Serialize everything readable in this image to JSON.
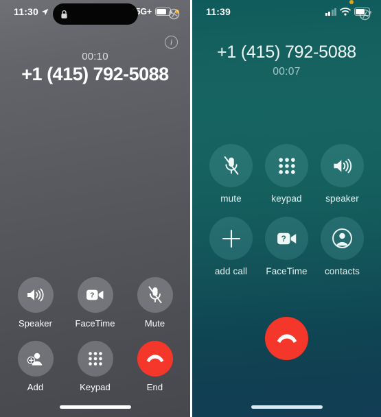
{
  "left_phone": {
    "status_bar": {
      "clock": "11:30",
      "location_icon": "location-arrow-icon",
      "island_lock_icon": "lock-icon",
      "signal_icon": "cellular-bars-icon",
      "network_label": "5G+",
      "battery_icon": "battery-icon",
      "battery_level_percent": 72,
      "mic_in_use_icon": "orange-privacy-dot-icon",
      "corner_icon": "screen-record-icon"
    },
    "info_button_label": "i",
    "call": {
      "duration": "00:10",
      "number": "+1 (415) 792-5088"
    },
    "buttons": [
      {
        "label": "Speaker",
        "icon": "speaker-icon",
        "style": "normal"
      },
      {
        "label": "FaceTime",
        "icon": "facetime-video-icon",
        "style": "normal"
      },
      {
        "label": "Mute",
        "icon": "mic-muted-icon",
        "style": "normal"
      },
      {
        "label": "Add",
        "icon": "add-contact-icon",
        "style": "normal"
      },
      {
        "label": "Keypad",
        "icon": "keypad-icon",
        "style": "normal"
      },
      {
        "label": "End",
        "icon": "end-call-icon",
        "style": "destructive"
      }
    ],
    "home_indicator": "home-indicator"
  },
  "right_phone": {
    "status_bar": {
      "clock": "11:39",
      "signal_icon": "cellular-bars-icon",
      "wifi_icon": "wifi-icon",
      "battery_icon": "battery-icon",
      "battery_level_percent": 70,
      "mic_in_use_icon": "orange-privacy-dot-icon",
      "corner_icon": "screen-record-icon"
    },
    "call": {
      "number": "+1 (415) 792-5088",
      "duration": "00:07"
    },
    "buttons": [
      {
        "label": "mute",
        "icon": "mic-muted-icon"
      },
      {
        "label": "keypad",
        "icon": "keypad-icon"
      },
      {
        "label": "speaker",
        "icon": "speaker-icon"
      },
      {
        "label": "add call",
        "icon": "plus-icon"
      },
      {
        "label": "FaceTime",
        "icon": "facetime-video-icon"
      },
      {
        "label": "contacts",
        "icon": "contacts-person-icon"
      }
    ],
    "end_call_icon": "end-call-icon",
    "home_indicator": "home-indicator"
  },
  "colors": {
    "destructive_red": "#f5372b",
    "left_background": "#56585e",
    "right_background_top": "#166462",
    "right_background_bottom": "#123d54",
    "privacy_dot_orange": "#e8a317",
    "text_primary": "#ffffff"
  }
}
